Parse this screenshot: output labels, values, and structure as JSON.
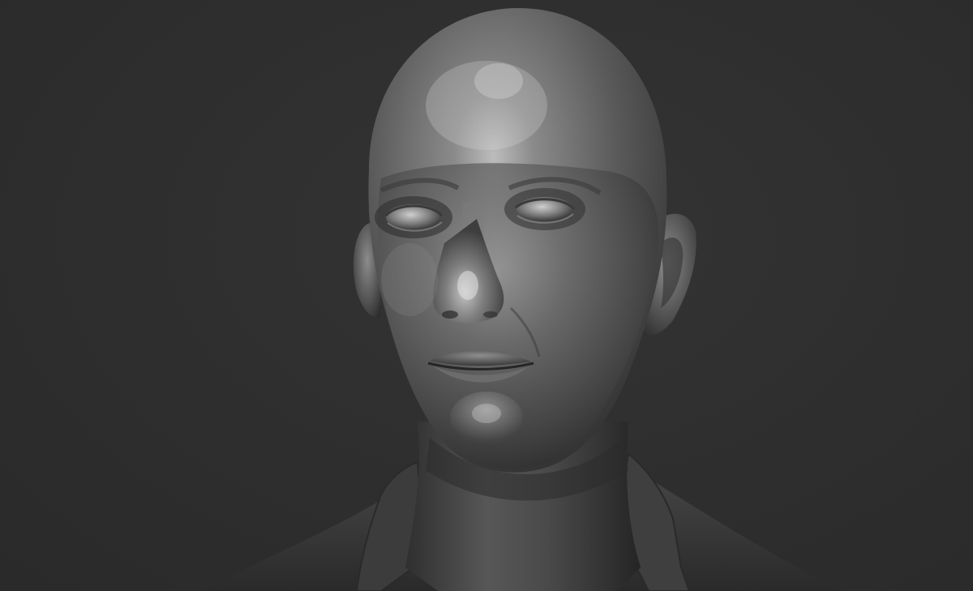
{
  "scene": {
    "subject": "sculpted-head-bust",
    "colors": {
      "background": "#2f2f2f",
      "material_light": "#9a9a9a",
      "material_mid": "#5e5e5e",
      "material_dark": "#262626",
      "specular": "#d8d8d8"
    }
  }
}
